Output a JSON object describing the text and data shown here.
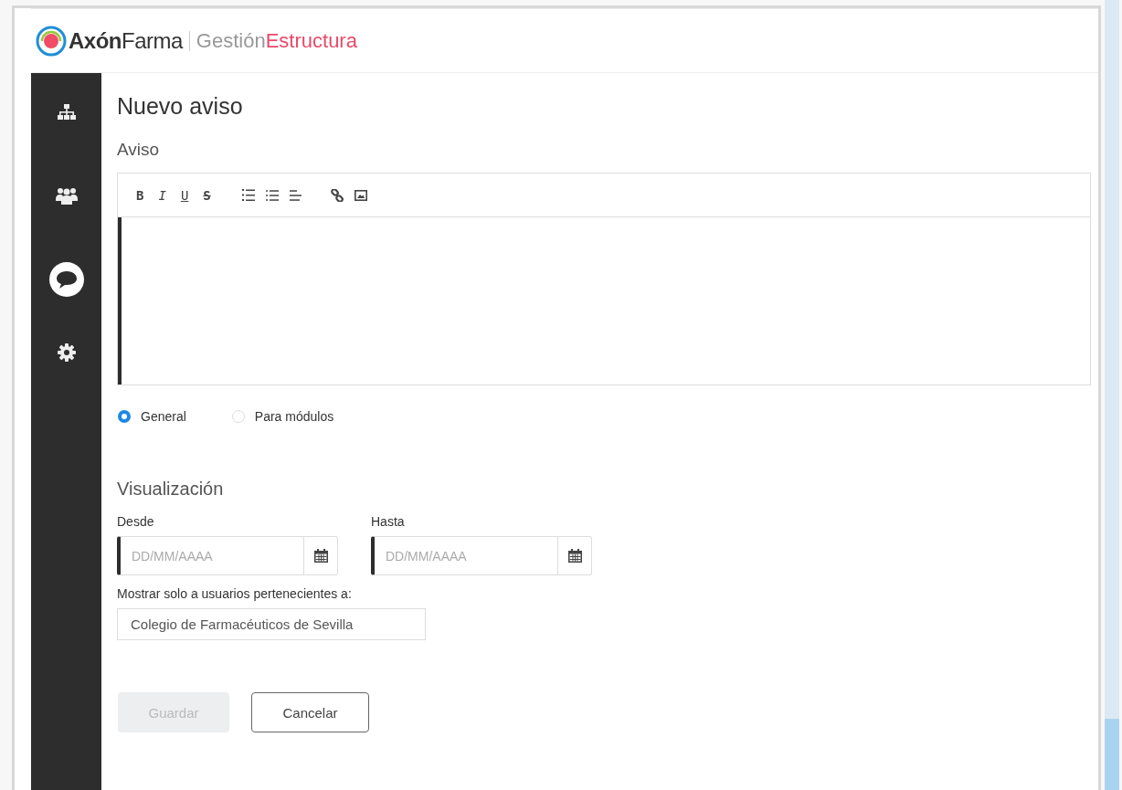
{
  "header": {
    "brand": "**Axón**Farma",
    "product": "Gestión",
    "product_accent": "Estructura"
  },
  "sidebar": {
    "items": [
      {
        "kind": "hierarchy",
        "selected": false
      },
      {
        "kind": "users",
        "selected": false
      },
      {
        "kind": "chat",
        "selected": true
      },
      {
        "kind": "settings",
        "selected": false
      }
    ]
  },
  "page_title": "Nuevo aviso",
  "editor": {
    "label": "Aviso",
    "format_buttons": [
      {
        "kind": "bold",
        "text": "B"
      },
      {
        "kind": "italic",
        "text": "I"
      },
      {
        "kind": "underline",
        "text": "U"
      },
      {
        "kind": "strike",
        "text": "S"
      }
    ],
    "tools": [
      {
        "kind": "ordered-list"
      },
      {
        "kind": "bullet-list"
      },
      {
        "kind": "align"
      },
      {
        "kind": "link"
      },
      {
        "kind": "image"
      }
    ]
  },
  "scope": [
    {
      "label": "General",
      "selected": true
    },
    {
      "label": "Para módulos",
      "selected": false
    }
  ],
  "visualization": {
    "title": "Visualización",
    "dates": [
      {
        "label": "Desde",
        "placeholder": "DD/MM/AAAA"
      },
      {
        "label": "Hasta",
        "placeholder": "DD/MM/AAAA"
      }
    ],
    "audience_label": "Mostrar solo a usuarios pertenecientes a:",
    "audience": "Colegio de Farmacéuticos de Sevilla"
  },
  "buttons": [
    {
      "label": "Guardar",
      "disabled": true
    },
    {
      "label": "Cancelar",
      "disabled": false
    }
  ]
}
